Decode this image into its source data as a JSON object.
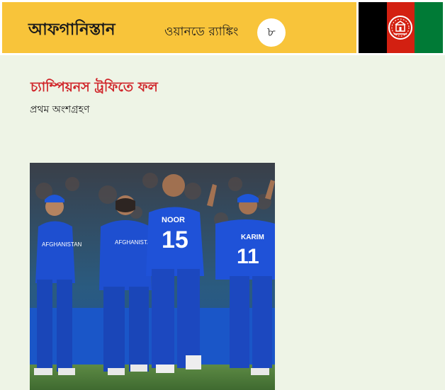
{
  "header": {
    "country": "আফগানিস্তান",
    "ranking_label": "ওয়ানডে র‌্যাঙ্কিং",
    "ranking_value": "৮",
    "flag_colors": [
      "#000000",
      "#d32011",
      "#007a36"
    ],
    "flag_icon": "afghanistan-flag-icon"
  },
  "section": {
    "title": "চ্যাম্পিয়নস ট্রফিতে ফল",
    "subtitle": "প্রথম অংশগ্রহণ"
  },
  "photo": {
    "subject": "afghanistan-team-celebration-photo",
    "jersey_texts": [
      "AFGHANISTAN",
      "AFGHANISTAN",
      "NOOR",
      "15",
      "KARIM",
      "11"
    ],
    "accent_colors": {
      "jersey": "#1e4fd0",
      "field": "#4d7a3a"
    }
  },
  "colors": {
    "header_band": "#f8c43a",
    "background": "#eef4e6",
    "title": "#d0252a"
  }
}
